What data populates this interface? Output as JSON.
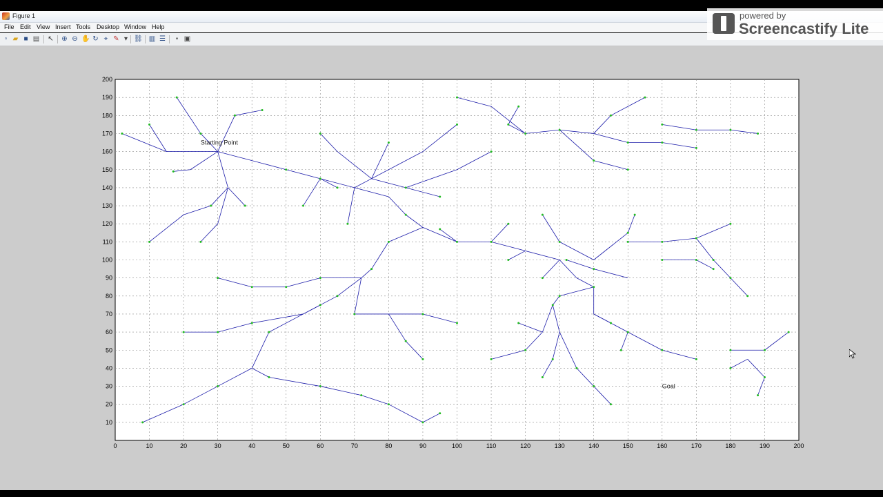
{
  "window": {
    "title": "Figure 1"
  },
  "menu": [
    "File",
    "Edit",
    "View",
    "Insert",
    "Tools",
    "Desktop",
    "Window",
    "Help"
  ],
  "toolbar_icons": [
    "new-figure-icon",
    "open-file-icon",
    "save-icon",
    "print-icon",
    "select-arrow-icon",
    "zoom-in-icon",
    "zoom-out-icon",
    "pan-hand-icon",
    "rotate-3d-icon",
    "data-cursor-icon",
    "brush-icon",
    "link-plot-icon",
    "colorbar-icon",
    "legend-icon",
    "hide-plot-tools-icon",
    "show-plot-tools-icon"
  ],
  "watermark": {
    "top": "powered by",
    "main": "Screencastify Lite"
  },
  "colors": {
    "edge": "#1a1aa8",
    "node": "#22bb22",
    "figure_bg": "#cccccc"
  },
  "chart_data": {
    "type": "scatter",
    "title": "",
    "xlabel": "",
    "ylabel": "",
    "xlim": [
      0,
      200
    ],
    "ylim": [
      0,
      200
    ],
    "grid": true,
    "xticks": [
      "0",
      "10",
      "20",
      "30",
      "40",
      "50",
      "60",
      "70",
      "80",
      "90",
      "100",
      "110",
      "120",
      "130",
      "140",
      "150",
      "160",
      "170",
      "180",
      "190",
      "200"
    ],
    "yticks": [
      "10",
      "20",
      "30",
      "40",
      "50",
      "60",
      "70",
      "80",
      "90",
      "100",
      "110",
      "120",
      "130",
      "140",
      "150",
      "160",
      "170",
      "180",
      "190",
      "200"
    ],
    "annotations": [
      {
        "text": "Starting Point",
        "x": 25,
        "y": 165
      },
      {
        "text": "Goal",
        "x": 160,
        "y": 30
      }
    ],
    "series": [
      {
        "type": "tree-edges",
        "segments": [
          [
            30,
            160,
            35,
            180
          ],
          [
            35,
            180,
            43,
            183
          ],
          [
            30,
            160,
            25,
            170
          ],
          [
            25,
            170,
            18,
            190
          ],
          [
            30,
            160,
            15,
            160
          ],
          [
            15,
            160,
            2,
            170
          ],
          [
            15,
            160,
            10,
            175
          ],
          [
            30,
            160,
            22,
            150
          ],
          [
            22,
            150,
            17,
            149
          ],
          [
            30,
            160,
            40,
            155
          ],
          [
            40,
            155,
            50,
            150
          ],
          [
            50,
            150,
            60,
            145
          ],
          [
            60,
            145,
            70,
            140
          ],
          [
            70,
            140,
            80,
            135
          ],
          [
            80,
            135,
            85,
            125
          ],
          [
            85,
            125,
            90,
            118
          ],
          [
            90,
            118,
            100,
            110
          ],
          [
            100,
            110,
            110,
            110
          ],
          [
            110,
            110,
            120,
            105
          ],
          [
            120,
            105,
            130,
            100
          ],
          [
            130,
            100,
            135,
            90
          ],
          [
            135,
            90,
            140,
            85
          ],
          [
            140,
            85,
            140,
            70
          ],
          [
            140,
            70,
            150,
            60
          ],
          [
            150,
            60,
            160,
            50
          ],
          [
            160,
            50,
            170,
            45
          ],
          [
            150,
            60,
            148,
            50
          ],
          [
            140,
            70,
            145,
            65
          ],
          [
            130,
            100,
            125,
            90
          ],
          [
            120,
            105,
            115,
            100
          ],
          [
            110,
            110,
            115,
            120
          ],
          [
            100,
            110,
            95,
            117
          ],
          [
            30,
            160,
            33,
            140
          ],
          [
            33,
            140,
            28,
            130
          ],
          [
            28,
            130,
            20,
            125
          ],
          [
            20,
            125,
            10,
            110
          ],
          [
            33,
            140,
            30,
            120
          ],
          [
            30,
            120,
            25,
            110
          ],
          [
            33,
            140,
            38,
            130
          ],
          [
            60,
            145,
            55,
            130
          ],
          [
            60,
            145,
            65,
            140
          ],
          [
            70,
            140,
            68,
            120
          ],
          [
            70,
            140,
            75,
            145
          ],
          [
            75,
            145,
            85,
            140
          ],
          [
            85,
            140,
            95,
            135
          ],
          [
            75,
            145,
            90,
            160
          ],
          [
            90,
            160,
            100,
            175
          ],
          [
            75,
            145,
            80,
            165
          ],
          [
            75,
            145,
            65,
            160
          ],
          [
            65,
            160,
            60,
            170
          ],
          [
            85,
            140,
            100,
            150
          ],
          [
            100,
            150,
            110,
            160
          ],
          [
            90,
            118,
            80,
            110
          ],
          [
            80,
            110,
            75,
            95
          ],
          [
            75,
            95,
            72,
            90
          ],
          [
            72,
            90,
            65,
            80
          ],
          [
            65,
            80,
            55,
            70
          ],
          [
            55,
            70,
            45,
            60
          ],
          [
            45,
            60,
            40,
            40
          ],
          [
            40,
            40,
            30,
            30
          ],
          [
            30,
            30,
            20,
            20
          ],
          [
            20,
            20,
            8,
            10
          ],
          [
            40,
            40,
            45,
            35
          ],
          [
            45,
            35,
            60,
            30
          ],
          [
            60,
            30,
            72,
            25
          ],
          [
            72,
            25,
            80,
            20
          ],
          [
            80,
            20,
            90,
            10
          ],
          [
            90,
            10,
            95,
            15
          ],
          [
            55,
            70,
            40,
            65
          ],
          [
            40,
            65,
            30,
            60
          ],
          [
            30,
            60,
            20,
            60
          ],
          [
            72,
            90,
            70,
            70
          ],
          [
            70,
            70,
            80,
            70
          ],
          [
            80,
            70,
            90,
            70
          ],
          [
            90,
            70,
            100,
            65
          ],
          [
            80,
            70,
            85,
            55
          ],
          [
            85,
            55,
            90,
            45
          ],
          [
            72,
            90,
            60,
            90
          ],
          [
            60,
            90,
            50,
            85
          ],
          [
            50,
            85,
            40,
            85
          ],
          [
            40,
            85,
            30,
            90
          ],
          [
            55,
            70,
            60,
            75
          ],
          [
            120,
            170,
            130,
            172
          ],
          [
            130,
            172,
            140,
            170
          ],
          [
            140,
            170,
            150,
            165
          ],
          [
            150,
            165,
            160,
            165
          ],
          [
            160,
            165,
            170,
            162
          ],
          [
            140,
            170,
            145,
            180
          ],
          [
            145,
            180,
            155,
            190
          ],
          [
            120,
            170,
            115,
            175
          ],
          [
            115,
            175,
            118,
            185
          ],
          [
            120,
            170,
            110,
            185
          ],
          [
            110,
            185,
            100,
            190
          ],
          [
            130,
            172,
            140,
            155
          ],
          [
            140,
            155,
            150,
            150
          ],
          [
            160,
            175,
            170,
            172
          ],
          [
            170,
            172,
            180,
            172
          ],
          [
            180,
            172,
            188,
            170
          ],
          [
            140,
            85,
            130,
            80
          ],
          [
            130,
            80,
            128,
            75
          ],
          [
            128,
            75,
            125,
            60
          ],
          [
            125,
            60,
            120,
            50
          ],
          [
            120,
            50,
            110,
            45
          ],
          [
            128,
            75,
            130,
            60
          ],
          [
            130,
            60,
            128,
            45
          ],
          [
            128,
            45,
            125,
            35
          ],
          [
            130,
            60,
            135,
            40
          ],
          [
            135,
            40,
            140,
            30
          ],
          [
            140,
            30,
            145,
            20
          ],
          [
            125,
            60,
            118,
            65
          ],
          [
            150,
            110,
            160,
            110
          ],
          [
            160,
            110,
            170,
            112
          ],
          [
            170,
            112,
            180,
            120
          ],
          [
            170,
            112,
            175,
            100
          ],
          [
            175,
            100,
            180,
            90
          ],
          [
            180,
            90,
            185,
            80
          ],
          [
            180,
            50,
            190,
            50
          ],
          [
            190,
            50,
            197,
            60
          ],
          [
            185,
            45,
            190,
            35
          ],
          [
            185,
            45,
            180,
            40
          ],
          [
            190,
            35,
            188,
            25
          ],
          [
            140,
            100,
            130,
            110
          ],
          [
            130,
            110,
            125,
            125
          ],
          [
            140,
            100,
            150,
            115
          ],
          [
            150,
            115,
            152,
            125
          ],
          [
            150,
            90,
            140,
            95
          ],
          [
            140,
            95,
            132,
            100
          ],
          [
            160,
            100,
            170,
            100
          ],
          [
            170,
            100,
            175,
            95
          ]
        ]
      },
      {
        "type": "nodes",
        "points": [
          [
            35,
            180
          ],
          [
            43,
            183
          ],
          [
            25,
            170
          ],
          [
            18,
            190
          ],
          [
            2,
            170
          ],
          [
            10,
            175
          ],
          [
            17,
            149
          ],
          [
            50,
            150
          ],
          [
            60,
            145
          ],
          [
            85,
            125
          ],
          [
            100,
            110
          ],
          [
            110,
            110
          ],
          [
            140,
            85
          ],
          [
            150,
            60
          ],
          [
            160,
            50
          ],
          [
            170,
            45
          ],
          [
            148,
            50
          ],
          [
            145,
            65
          ],
          [
            125,
            90
          ],
          [
            115,
            100
          ],
          [
            115,
            120
          ],
          [
            95,
            117
          ],
          [
            28,
            130
          ],
          [
            10,
            110
          ],
          [
            25,
            110
          ],
          [
            38,
            130
          ],
          [
            55,
            130
          ],
          [
            65,
            140
          ],
          [
            68,
            120
          ],
          [
            85,
            140
          ],
          [
            95,
            135
          ],
          [
            100,
            175
          ],
          [
            80,
            165
          ],
          [
            60,
            170
          ],
          [
            110,
            160
          ],
          [
            80,
            110
          ],
          [
            75,
            95
          ],
          [
            65,
            80
          ],
          [
            45,
            60
          ],
          [
            30,
            30
          ],
          [
            20,
            20
          ],
          [
            8,
            10
          ],
          [
            45,
            35
          ],
          [
            60,
            30
          ],
          [
            72,
            25
          ],
          [
            80,
            20
          ],
          [
            90,
            10
          ],
          [
            95,
            15
          ],
          [
            40,
            65
          ],
          [
            30,
            60
          ],
          [
            20,
            60
          ],
          [
            70,
            70
          ],
          [
            90,
            70
          ],
          [
            100,
            65
          ],
          [
            85,
            55
          ],
          [
            90,
            45
          ],
          [
            60,
            90
          ],
          [
            50,
            85
          ],
          [
            40,
            85
          ],
          [
            30,
            90
          ],
          [
            60,
            75
          ],
          [
            120,
            170
          ],
          [
            130,
            172
          ],
          [
            150,
            165
          ],
          [
            160,
            165
          ],
          [
            170,
            162
          ],
          [
            145,
            180
          ],
          [
            155,
            190
          ],
          [
            115,
            175
          ],
          [
            118,
            185
          ],
          [
            100,
            190
          ],
          [
            140,
            155
          ],
          [
            150,
            150
          ],
          [
            160,
            175
          ],
          [
            170,
            172
          ],
          [
            180,
            172
          ],
          [
            188,
            170
          ],
          [
            130,
            80
          ],
          [
            128,
            75
          ],
          [
            120,
            50
          ],
          [
            110,
            45
          ],
          [
            128,
            45
          ],
          [
            125,
            35
          ],
          [
            135,
            40
          ],
          [
            140,
            30
          ],
          [
            145,
            20
          ],
          [
            118,
            65
          ],
          [
            150,
            110
          ],
          [
            160,
            110
          ],
          [
            170,
            112
          ],
          [
            180,
            120
          ],
          [
            175,
            100
          ],
          [
            180,
            90
          ],
          [
            185,
            80
          ],
          [
            180,
            50
          ],
          [
            190,
            50
          ],
          [
            197,
            60
          ],
          [
            190,
            35
          ],
          [
            180,
            40
          ],
          [
            188,
            25
          ],
          [
            130,
            110
          ],
          [
            125,
            125
          ],
          [
            150,
            115
          ],
          [
            152,
            125
          ],
          [
            140,
            95
          ],
          [
            132,
            100
          ],
          [
            160,
            100
          ],
          [
            170,
            100
          ],
          [
            175,
            95
          ]
        ]
      }
    ]
  }
}
